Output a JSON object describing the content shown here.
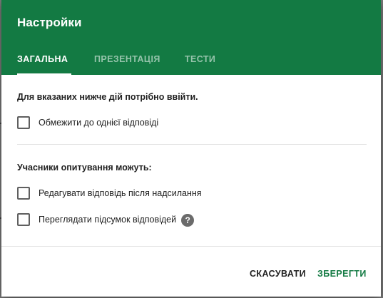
{
  "dialog": {
    "title": "Настройки",
    "tabs": [
      {
        "label": "ЗАГАЛЬНА",
        "active": true
      },
      {
        "label": "ПРЕЗЕНТАЦІЯ",
        "active": false
      },
      {
        "label": "ТЕСТИ",
        "active": false
      }
    ],
    "login_section": {
      "heading": "Для вказаних нижче дій потрібно ввійти.",
      "options": [
        {
          "label": "Обмежити до однієї відповіді",
          "checked": false
        }
      ]
    },
    "respondents_section": {
      "heading": "Учасники опитування можуть:",
      "options": [
        {
          "label": "Редагувати відповідь після надсилання",
          "checked": false
        },
        {
          "label": "Переглядати підсумок відповідей",
          "checked": false,
          "help_icon": "?"
        }
      ]
    },
    "actions": {
      "cancel_label": "СКАСУВАТИ",
      "save_label": "ЗБЕРЕГТИ"
    }
  },
  "colors": {
    "header_bg": "#137a43",
    "accent": "#137a43",
    "text": "#212121"
  }
}
